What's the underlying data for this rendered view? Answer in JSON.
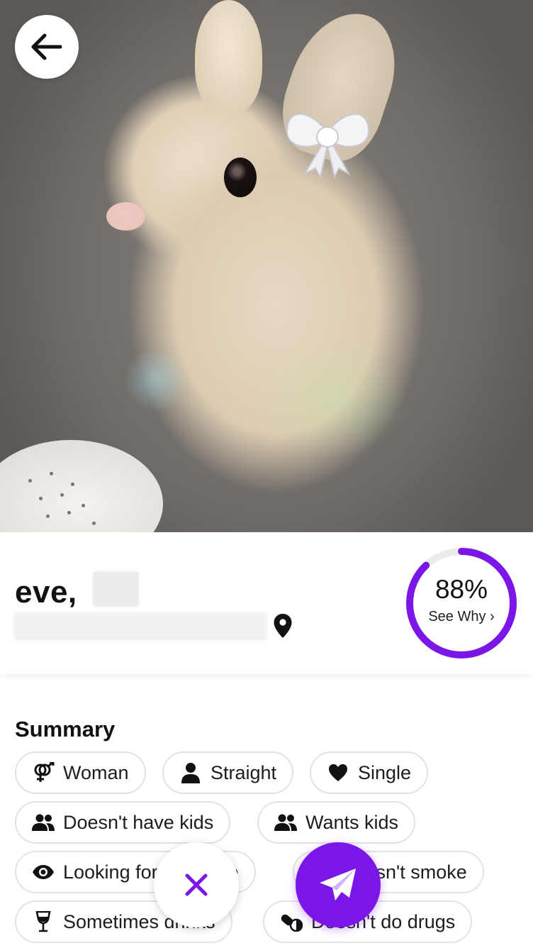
{
  "profile": {
    "name": "eve,",
    "match_percent": "88%",
    "match_link": "See Why ›",
    "match_value": 0.88
  },
  "summary": {
    "title": "Summary",
    "chips": [
      {
        "label": "Woman",
        "icon": "gender-icon"
      },
      {
        "label": "Straight",
        "icon": "person-icon"
      },
      {
        "label": "Single",
        "icon": "heart-icon"
      },
      {
        "label": "Doesn't have kids",
        "icon": "people-icon"
      },
      {
        "label": "Wants kids",
        "icon": "people-icon"
      },
      {
        "label": "Looking for marriage",
        "icon": "eye-icon"
      },
      {
        "label": "Doesn't smoke",
        "icon": "no-smoking-icon"
      },
      {
        "label": "Sometimes drinks",
        "icon": "wine-glass-icon"
      },
      {
        "label": "Doesn't do drugs",
        "icon": "pills-icon"
      }
    ]
  },
  "colors": {
    "accent": "#7b16e8",
    "ring_track": "#ececec"
  }
}
